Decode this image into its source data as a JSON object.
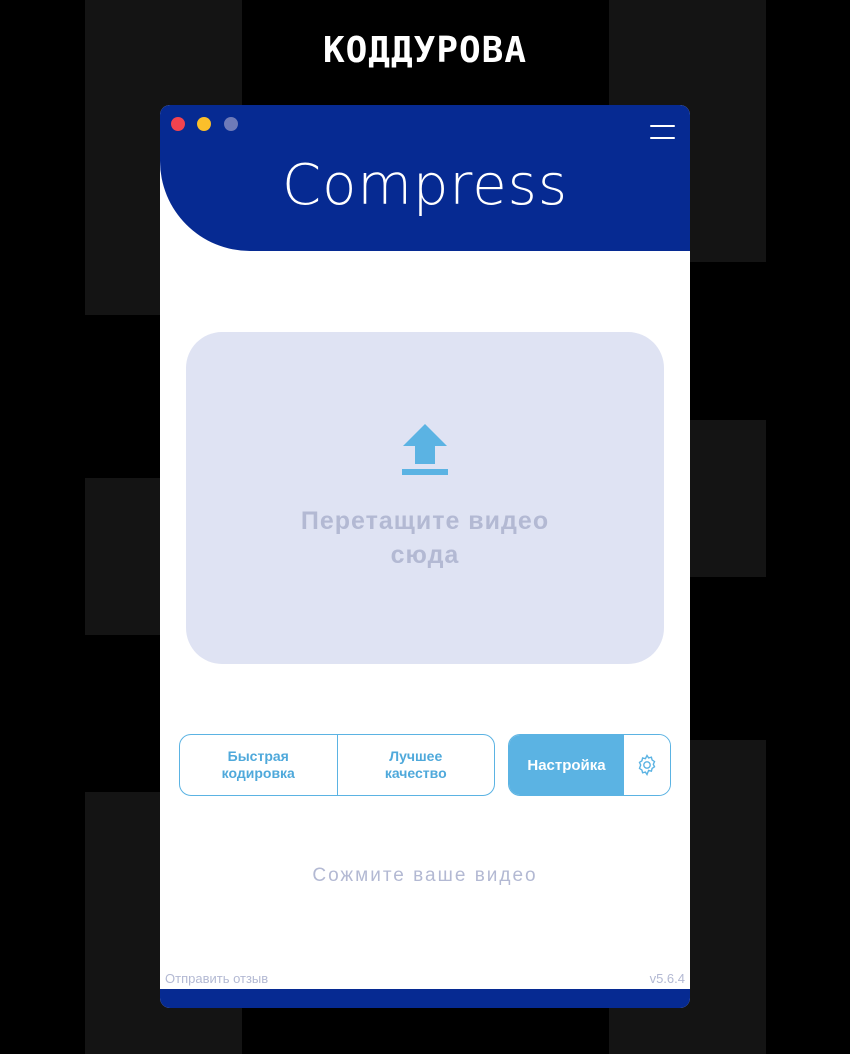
{
  "brand": {
    "text": "КОДДУРОВА"
  },
  "window": {
    "title": "Compress",
    "traffic_lights": [
      "#f2434f",
      "#fbbf2a",
      "#6e7ab8"
    ],
    "menu_icon": "hamburger-icon"
  },
  "dropzone": {
    "icon": "upload-arrow-icon",
    "line1": "Перетащите видео",
    "line2": "сюда"
  },
  "modes": {
    "fast": {
      "line1": "Быстрая",
      "line2": "кодировка"
    },
    "quality": {
      "line1": "Лучшее",
      "line2": "качество"
    }
  },
  "settings": {
    "label": "Настройка",
    "icon": "gear-icon"
  },
  "tagline": "Сожмите ваше видео",
  "footer": {
    "feedback": "Отправить отзыв",
    "version": "v5.6.4"
  },
  "colors": {
    "primary": "#062a92",
    "accent": "#5bb3e3",
    "muted": "#b3b9d3",
    "dropzone_bg": "#dfe3f3"
  }
}
